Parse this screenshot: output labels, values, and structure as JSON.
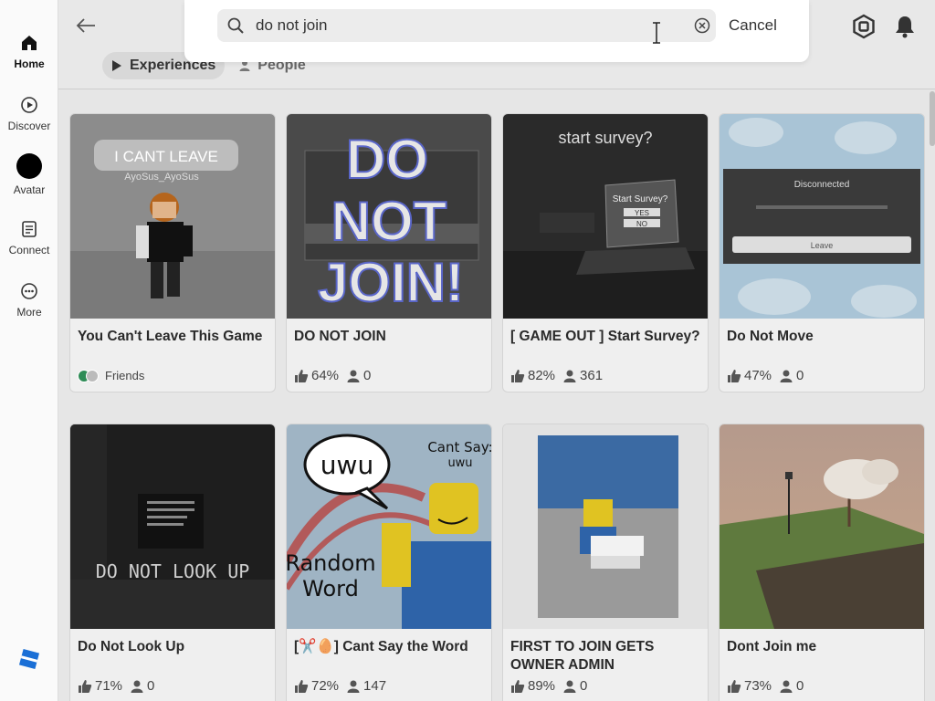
{
  "sidebar": {
    "items": [
      {
        "label": "Home",
        "icon": "home-icon"
      },
      {
        "label": "Discover",
        "icon": "play-circle-icon"
      },
      {
        "label": "Avatar",
        "icon": "avatar-icon"
      },
      {
        "label": "Connect",
        "icon": "chat-icon"
      },
      {
        "label": "More",
        "icon": "more-icon"
      }
    ],
    "logo": "roblox-logo-icon"
  },
  "search": {
    "value": "do not join",
    "cancel_label": "Cancel"
  },
  "filters": [
    {
      "label": "Experiences",
      "active": true
    },
    {
      "label": "People",
      "active": false
    }
  ],
  "cards": [
    {
      "title": "You Can't Leave This Game",
      "friends_label": "Friends",
      "thumb_text": [
        "I CANT LEAVE",
        "AyoSus_AyoSus"
      ]
    },
    {
      "title": "DO NOT JOIN",
      "like": "64%",
      "players": "0",
      "thumb_text": [
        "DO",
        "NOT",
        "JOIN!"
      ]
    },
    {
      "title": "[ GAME OUT ] Start Survey?",
      "like": "82%",
      "players": "361",
      "thumb_text": [
        "start survey?",
        "Start Survey?",
        "YES",
        "NO"
      ]
    },
    {
      "title": "Do Not Move",
      "like": "47%",
      "players": "0",
      "thumb_text": [
        "Disconnected",
        "Leave"
      ]
    },
    {
      "title": "Do Not Look Up",
      "like": "71%",
      "players": "0",
      "thumb_text": [
        "DO NOT LOOK UP"
      ]
    },
    {
      "title": "[✂️🥚] Cant Say the Word",
      "like": "72%",
      "players": "147",
      "thumb_text": [
        "uwu",
        "Cant Say:",
        "uwu",
        "Random",
        "Word"
      ]
    },
    {
      "title": "FIRST TO JOIN GETS OWNER ADMIN",
      "like": "89%",
      "players": "0"
    },
    {
      "title": "Dont Join me",
      "like": "73%",
      "players": "0"
    }
  ],
  "colors": {
    "accent": "#1a6fd6",
    "friend_online": "#2f8c57",
    "dim_overlay": "#e6e6e6"
  }
}
